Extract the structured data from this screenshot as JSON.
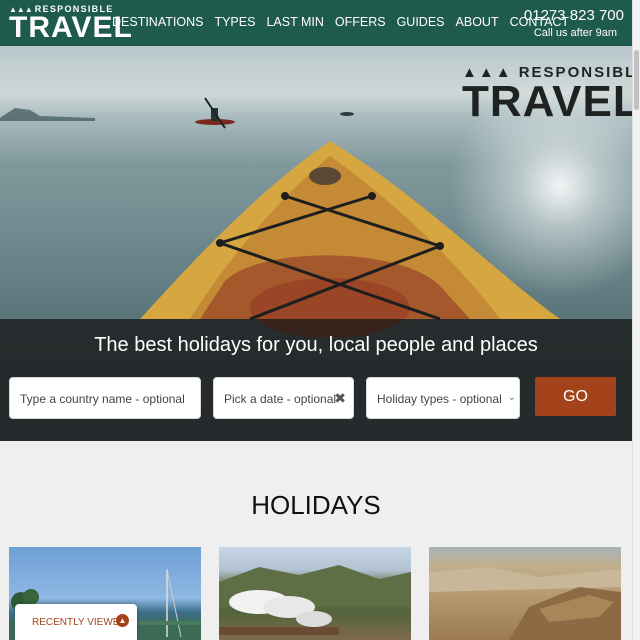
{
  "header": {
    "logo_small": "RESPONSIBLE",
    "logo_big": "TRAVEL",
    "nav": [
      "DESTINATIONS",
      "TYPES",
      "LAST MIN",
      "OFFERS",
      "GUIDES",
      "ABOUT",
      "CONTACT"
    ],
    "phone": "01273 823 700",
    "call_note": "Call us after 9am"
  },
  "hero": {
    "logo_small": "RESPONSIBLE",
    "logo_big": "TRAVEL",
    "tagline": "The best holidays for you, local people and places",
    "search": {
      "country_placeholder": "Type a country name - optional",
      "date_placeholder": "Pick a date  - optional",
      "types_placeholder": "Holiday types - optional",
      "go_label": "GO"
    }
  },
  "holidays": {
    "title": "HOLIDAYS"
  },
  "recently_viewed": {
    "label": "RECENTLY VIEWED"
  },
  "icons": {
    "tree": "tree-icon",
    "clear": "close-icon",
    "select": "chevron-down-icon",
    "recent": "chevron-up-icon"
  },
  "colors": {
    "brand_green": "#1f5b4c",
    "accent_rust": "#a4431b",
    "band_dark": "#191919"
  }
}
